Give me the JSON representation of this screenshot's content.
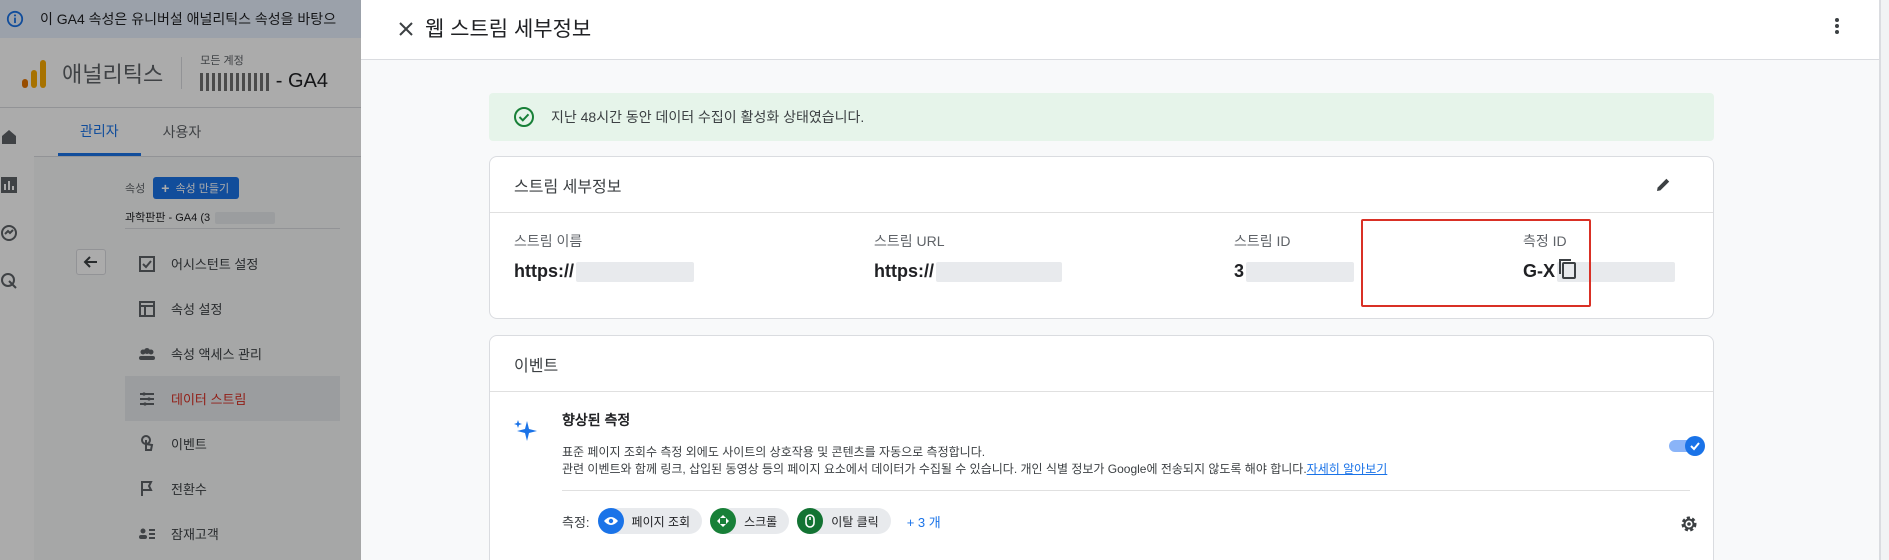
{
  "banner": {
    "text": "이 GA4 속성은 유니버설 애널리틱스 속성을 바탕으"
  },
  "topbar": {
    "app_name": "애널리틱스",
    "account_label": "모든 계정",
    "account_name": "- GA4"
  },
  "admin": {
    "tabs": [
      {
        "label": "관리자"
      },
      {
        "label": "사용자"
      }
    ],
    "property_label": "속성",
    "create_property_button": "속성 만들기",
    "property_name": "과학판판 - GA4 (3",
    "nav_items": [
      {
        "label": "어시스턴트 설정",
        "icon": "checklist-icon"
      },
      {
        "label": "속성 설정",
        "icon": "layout-icon"
      },
      {
        "label": "속성 액세스 관리",
        "icon": "people-icon"
      },
      {
        "label": "데이터 스트림",
        "icon": "streams-icon"
      },
      {
        "label": "이벤트",
        "icon": "touch-icon"
      },
      {
        "label": "전환수",
        "icon": "flag-icon"
      },
      {
        "label": "잠재고객",
        "icon": "audience-icon"
      }
    ]
  },
  "drawer": {
    "title": "웹 스트림 세부정보",
    "status_message": "지난 48시간 동안 데이터 수집이 활성화 상태였습니다.",
    "stream_details": {
      "heading": "스트림 세부정보",
      "fields": [
        {
          "label": "스트림 이름",
          "value": "https://"
        },
        {
          "label": "스트림 URL",
          "value": "https://"
        },
        {
          "label": "스트림 ID",
          "value": "3"
        },
        {
          "label": "측정 ID",
          "value": "G-X"
        }
      ]
    },
    "events": {
      "heading": "이벤트",
      "enhanced_title": "향상된 측정",
      "enhanced_desc_1": "표준 페이지 조회수 측정 외에도 사이트의 상호작용 및 콘텐츠를 자동으로 측정합니다.",
      "enhanced_desc_2": "관련 이벤트와 함께 링크, 삽입된 동영상 등의 페이지 요소에서 데이터가 수집될 수 있습니다. 개인 식별 정보가 Google에 전송되지 않도록 해야 합니다.",
      "learn_more": "자세히 알아보기",
      "toggle_on": true,
      "measure_label": "측정:",
      "chips": [
        {
          "label": "페이지 조회",
          "icon": "eye-icon",
          "color": "#1a73e8"
        },
        {
          "label": "스크롤",
          "icon": "scroll-icon",
          "color": "#188038"
        },
        {
          "label": "이탈 클릭",
          "icon": "mouse-icon",
          "color": "#137333"
        }
      ],
      "more": "+ 3 개"
    }
  }
}
